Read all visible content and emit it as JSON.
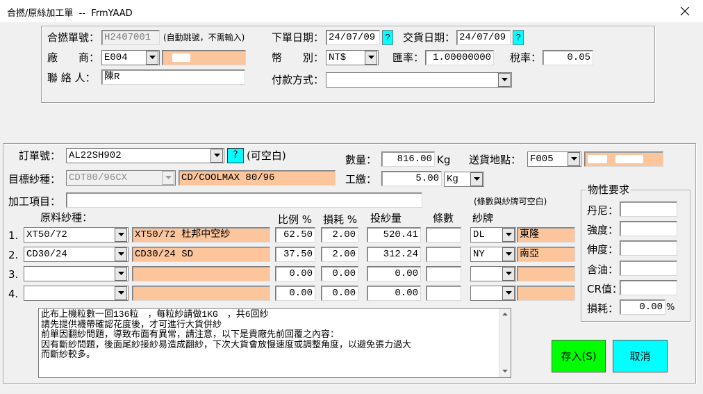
{
  "window": {
    "title": "合撚/原絲加工單  --  FrmYAAD"
  },
  "header": {
    "order_no_label": "合撚單號：",
    "order_no": "H2407001",
    "order_no_note": "(自動跳號，不需輸入)",
    "order_date_label": "下單日期：",
    "order_date": "24/07/09",
    "delivery_date_label": "交貨日期：",
    "delivery_date": "24/07/09",
    "help_glyph": "?",
    "vendor_label": "廠　　商：",
    "vendor_code": "E004",
    "currency_label": "幣　　別：",
    "currency": "NT$",
    "rate_label": "匯率：",
    "rate": "1.00000000",
    "tax_label": "稅率：",
    "tax": "0.05",
    "contact_label": "聯 絡 人：",
    "contact": "陳R",
    "payment_label": "付款方式：",
    "payment": ""
  },
  "order": {
    "order_label": "訂單號：",
    "order_value": "AL22SH902",
    "help_glyph": "?",
    "order_note": "(可空白)",
    "target_label": "目標紗種：",
    "target_code": "CDT80/96CX",
    "target_name": "CD/COOLMAX 80/96",
    "qty_label": "數量：",
    "qty": "816.00",
    "qty_unit": "Kg",
    "fee_label": "工繳：",
    "fee": "5.00",
    "fee_unit": "Kg",
    "ship_label": "送貨地點：",
    "ship_code": "F005",
    "process_label": "加工項目：",
    "process_value": "",
    "note_brand": "(條數與紗牌可空白)"
  },
  "table": {
    "headers": {
      "yarn": "原料紗種：",
      "ratio": "比例 %",
      "loss": "損耗 %",
      "feed": "投紗量",
      "count": "條數",
      "brand": "紗牌"
    },
    "rows": [
      {
        "no": "1.",
        "code": "XT50/72",
        "name": "XT50/72 杜邦中空紗",
        "ratio": "62.50",
        "loss": "2.00",
        "feed": "520.41",
        "count": "",
        "brand_code": "DL",
        "brand_name": "東隆"
      },
      {
        "no": "2.",
        "code": "CD30/24",
        "name": "CD30/24 SD",
        "ratio": "37.50",
        "loss": "2.00",
        "feed": "312.24",
        "count": "",
        "brand_code": "NY",
        "brand_name": "南亞"
      },
      {
        "no": "3.",
        "code": "",
        "name": "",
        "ratio": "0.00",
        "loss": "0.00",
        "feed": "0.00",
        "count": "",
        "brand_code": "",
        "brand_name": ""
      },
      {
        "no": "4.",
        "code": "",
        "name": "",
        "ratio": "0.00",
        "loss": "0.00",
        "feed": "0.00",
        "count": "",
        "brand_code": "",
        "brand_name": ""
      }
    ]
  },
  "memo": "此布上機粒數一回136粒　，每粒紗請做1KG　，共6回紗\n請先提供襪帶確認花度後，才可進行大貨併紗\n前單因翻紗問題，導致布面有異常，請注意，以下是貴廠先前回覆之內容：\n因有斷紗問題，後面尾紗接紗易造成翻紗，下次大貨會放慢速度或調整角度，以避免張力過大\n而斷紗較多。",
  "properties": {
    "title": "物性要求",
    "denier_label": "丹尼：",
    "tenacity_label": "強度：",
    "elong_label": "伸度：",
    "oil_label": "含油：",
    "cr_label": "CR值：",
    "loss_label": "損耗：",
    "loss_value": "0.00",
    "loss_unit": "%"
  },
  "buttons": {
    "save": "存入(S)",
    "cancel": "取消"
  },
  "colors": {
    "peach": "#fcc59b",
    "cyan": "#00ffff",
    "save_green": "#00ff00"
  }
}
